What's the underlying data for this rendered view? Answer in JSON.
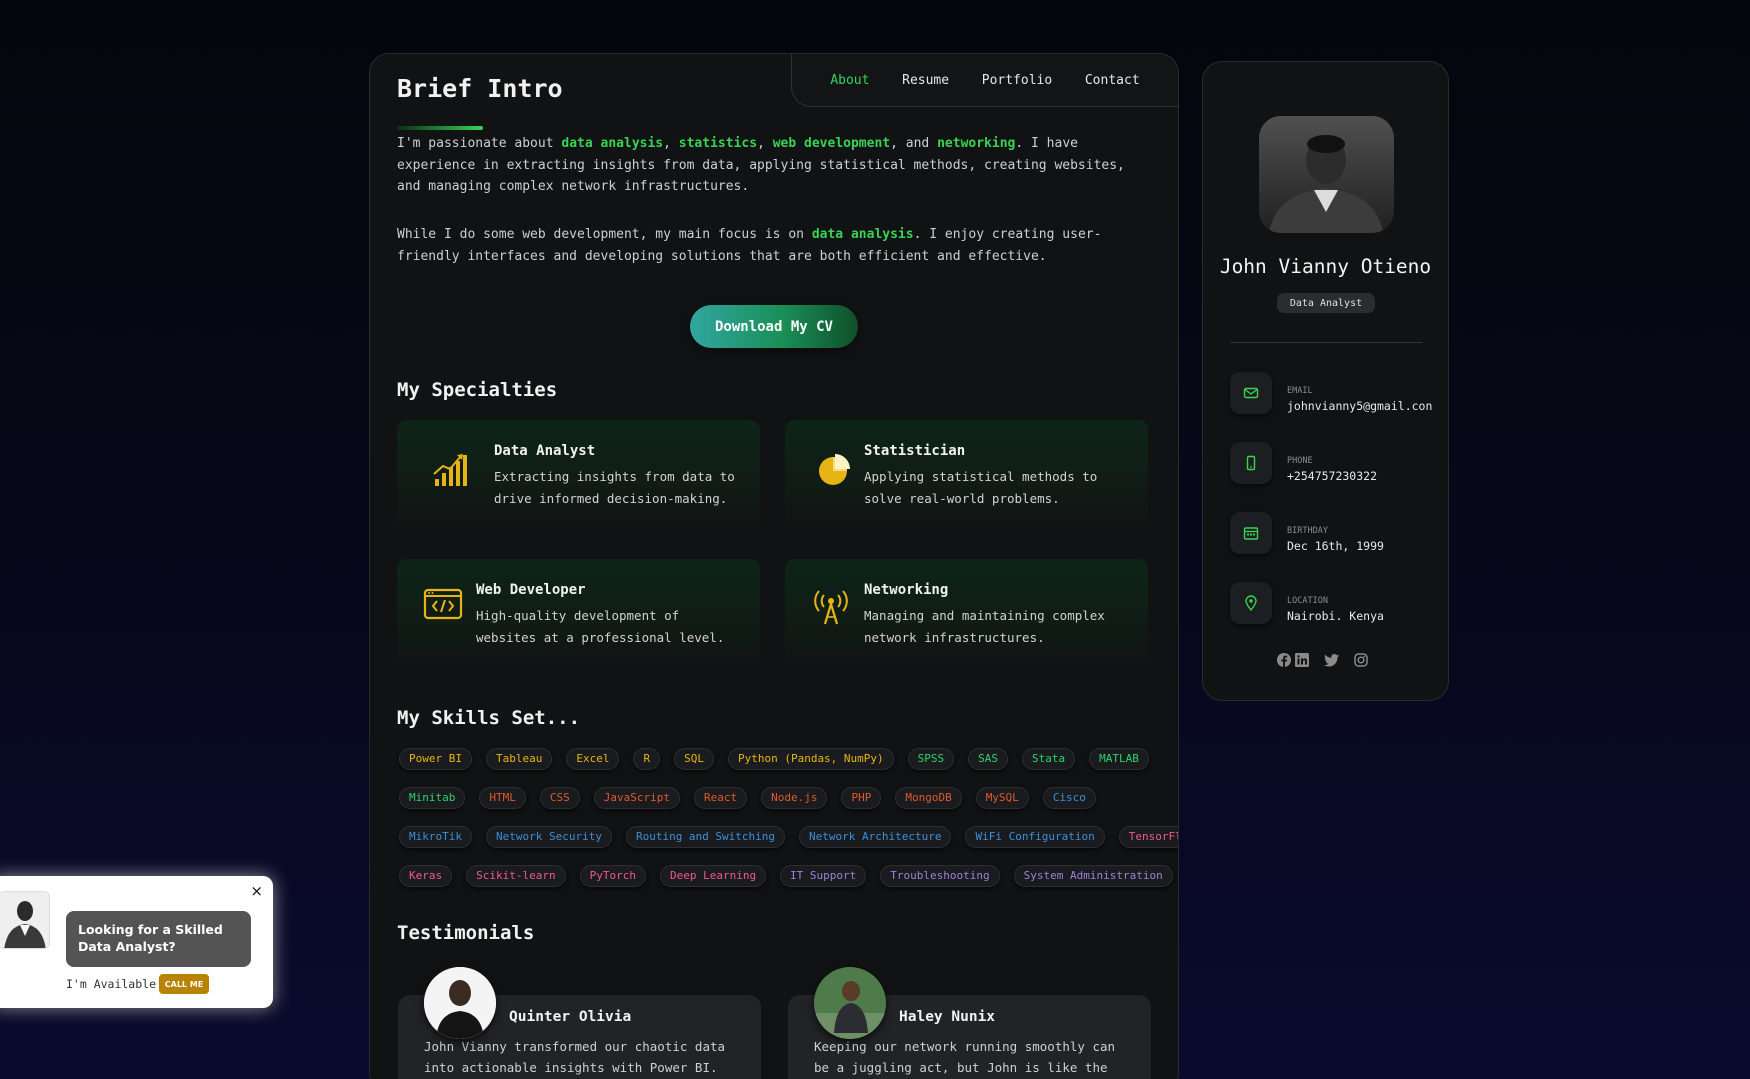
{
  "nav": {
    "items": [
      {
        "label": "About",
        "active": true
      },
      {
        "label": "Resume",
        "active": false
      },
      {
        "label": "Portfolio",
        "active": false
      },
      {
        "label": "Contact",
        "active": false
      }
    ]
  },
  "about": {
    "title": "Brief Intro",
    "para1": {
      "t1": "I'm passionate about ",
      "h1": "data analysis",
      "t2": ", ",
      "h2": "statistics",
      "t3": ", ",
      "h3": "web development",
      "t4": ", and ",
      "h4": "networking",
      "t5": ". I have experience in extracting insights from data, applying statistical methods, creating websites, and managing complex network infrastructures."
    },
    "para2": {
      "t1": "While I do some web development, my main focus is on ",
      "h1": "data analysis",
      "t2": ". I enjoy creating user-friendly interfaces and developing solutions that are both efficient and effective."
    },
    "cv_button": "Download My CV"
  },
  "specialties": {
    "title": "My Specialties",
    "items": [
      {
        "title": "Data Analyst",
        "desc": "Extracting insights from data to drive informed decision-making.",
        "icon": "bar-chart-icon"
      },
      {
        "title": "Statistician",
        "desc": "Applying statistical methods to solve real-world problems.",
        "icon": "pie-chart-icon"
      },
      {
        "title": "Web Developer",
        "desc": "High-quality development of websites at a professional level.",
        "icon": "code-window-icon"
      },
      {
        "title": "Networking",
        "desc": "Managing and maintaining complex network infrastructures.",
        "icon": "antenna-icon"
      }
    ]
  },
  "skills": {
    "title": "My Skills Set...",
    "rows": [
      [
        {
          "label": "Power BI",
          "color": "#e7b416"
        },
        {
          "label": "Tableau",
          "color": "#e7b416"
        },
        {
          "label": "Excel",
          "color": "#e7b416"
        },
        {
          "label": "R",
          "color": "#e7b416"
        },
        {
          "label": "SQL",
          "color": "#e7b416"
        },
        {
          "label": "Python (Pandas, NumPy)",
          "color": "#e7b416"
        },
        {
          "label": "SPSS",
          "color": "#2fd36b"
        },
        {
          "label": "SAS",
          "color": "#2fd36b"
        },
        {
          "label": "Stata",
          "color": "#2fd36b"
        },
        {
          "label": "MATLAB",
          "color": "#2fd36b"
        }
      ],
      [
        {
          "label": "Minitab",
          "color": "#2fd36b"
        },
        {
          "label": "HTML",
          "color": "#e05a2b"
        },
        {
          "label": "CSS",
          "color": "#e05a2b"
        },
        {
          "label": "JavaScript",
          "color": "#e05a2b"
        },
        {
          "label": "React",
          "color": "#e05a2b"
        },
        {
          "label": "Node.js",
          "color": "#e05a2b"
        },
        {
          "label": "PHP",
          "color": "#e05a2b"
        },
        {
          "label": "MongoDB",
          "color": "#e05a2b"
        },
        {
          "label": "MySQL",
          "color": "#e05a2b"
        },
        {
          "label": "Cisco",
          "color": "#3d8fd8"
        }
      ],
      [
        {
          "label": "MikroTik",
          "color": "#3d8fd8"
        },
        {
          "label": "Network Security",
          "color": "#3d8fd8"
        },
        {
          "label": "Routing and Switching",
          "color": "#3d8fd8"
        },
        {
          "label": "Network Architecture",
          "color": "#3d8fd8"
        },
        {
          "label": "WiFi Configuration",
          "color": "#3d8fd8"
        },
        {
          "label": "TensorFlow",
          "color": "#ee5a86"
        }
      ],
      [
        {
          "label": "Keras",
          "color": "#ee5a86"
        },
        {
          "label": "Scikit-learn",
          "color": "#ee5a86"
        },
        {
          "label": "PyTorch",
          "color": "#ee5a86"
        },
        {
          "label": "Deep Learning",
          "color": "#ee5a86"
        },
        {
          "label": "IT Support",
          "color": "#9c82d8"
        },
        {
          "label": "Troubleshooting",
          "color": "#9c82d8"
        },
        {
          "label": "System Administration",
          "color": "#9c82d8"
        }
      ]
    ]
  },
  "testimonials": {
    "title": "Testimonials",
    "items": [
      {
        "name": "Quinter Olivia",
        "text": "John Vianny transformed our chaotic data into actionable insights with Power BI. His..."
      },
      {
        "name": "Haley Nunix",
        "text": "Keeping our network running smoothly can be a juggling act, but John is like the ultimate..."
      }
    ]
  },
  "profile": {
    "name": "John Vianny Otieno",
    "role": "Data Analyst",
    "contacts": [
      {
        "label": "EMAIL",
        "value": "johnvianny5@gmail.con",
        "icon": "mail-icon"
      },
      {
        "label": "PHONE",
        "value": "+254757230322",
        "icon": "phone-icon"
      },
      {
        "label": "BIRTHDAY",
        "value": "Dec 16th, 1999",
        "icon": "calendar-icon"
      },
      {
        "label": "LOCATION",
        "value": "Nairobi. Kenya",
        "icon": "location-pin-icon"
      }
    ],
    "socials": [
      "facebook-icon",
      "linkedin-icon",
      "twitter-icon",
      "instagram-icon"
    ]
  },
  "popup": {
    "close": "×",
    "message": "Looking for a Skilled Data Analyst?",
    "available": "I'm Available!",
    "call_button": "CALL ME"
  },
  "colors": {
    "accent": "#39d353",
    "icon_gold": "#e7b416"
  }
}
